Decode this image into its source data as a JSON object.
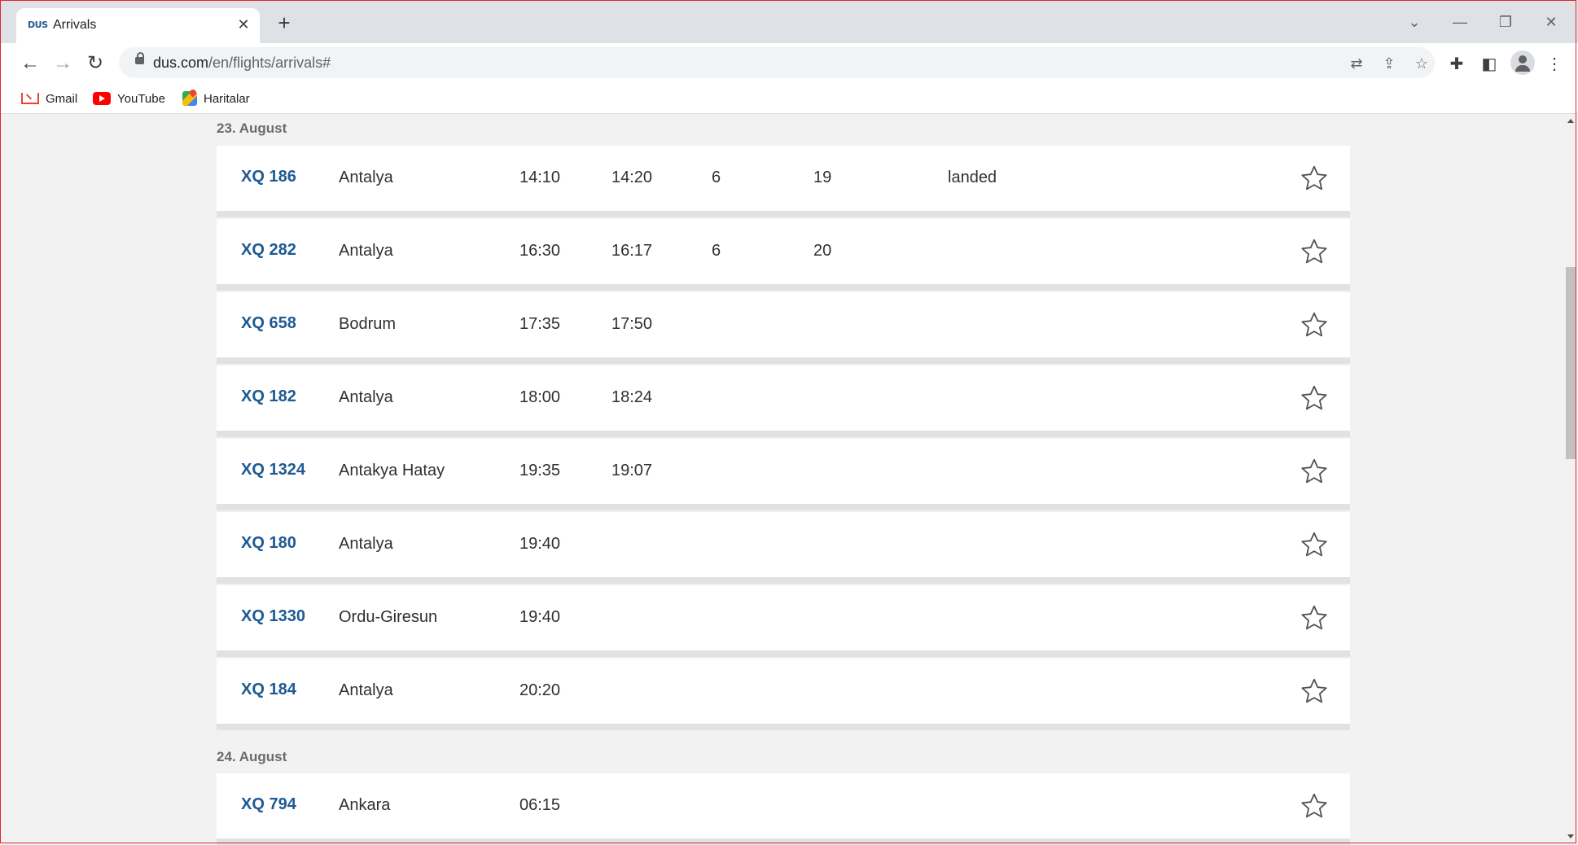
{
  "browser": {
    "tab_title": "Arrivals",
    "tab_favicon_text": "DUS",
    "url_host": "dus.com",
    "url_path": "/en/flights/arrivals#",
    "bookmarks": [
      {
        "label": "Gmail"
      },
      {
        "label": "YouTube"
      },
      {
        "label": "Haritalar"
      }
    ]
  },
  "sections": [
    {
      "date": "23. August",
      "flights": [
        {
          "flight": "XQ 186",
          "origin": "Antalya",
          "scheduled": "14:10",
          "expected": "14:20",
          "terminal": "6",
          "gate": "19",
          "status": "landed"
        },
        {
          "flight": "XQ 282",
          "origin": "Antalya",
          "scheduled": "16:30",
          "expected": "16:17",
          "terminal": "6",
          "gate": "20",
          "status": ""
        },
        {
          "flight": "XQ 658",
          "origin": "Bodrum",
          "scheduled": "17:35",
          "expected": "17:50",
          "terminal": "",
          "gate": "",
          "status": ""
        },
        {
          "flight": "XQ 182",
          "origin": "Antalya",
          "scheduled": "18:00",
          "expected": "18:24",
          "terminal": "",
          "gate": "",
          "status": ""
        },
        {
          "flight": "XQ 1324",
          "origin": "Antakya Hatay",
          "scheduled": "19:35",
          "expected": "19:07",
          "terminal": "",
          "gate": "",
          "status": ""
        },
        {
          "flight": "XQ 180",
          "origin": "Antalya",
          "scheduled": "19:40",
          "expected": "",
          "terminal": "",
          "gate": "",
          "status": ""
        },
        {
          "flight": "XQ 1330",
          "origin": "Ordu-Giresun",
          "scheduled": "19:40",
          "expected": "",
          "terminal": "",
          "gate": "",
          "status": ""
        },
        {
          "flight": "XQ 184",
          "origin": "Antalya",
          "scheduled": "20:20",
          "expected": "",
          "terminal": "",
          "gate": "",
          "status": ""
        }
      ]
    },
    {
      "date": "24. August",
      "flights": [
        {
          "flight": "XQ 794",
          "origin": "Ankara",
          "scheduled": "06:15",
          "expected": "",
          "terminal": "",
          "gate": "",
          "status": ""
        }
      ]
    }
  ]
}
